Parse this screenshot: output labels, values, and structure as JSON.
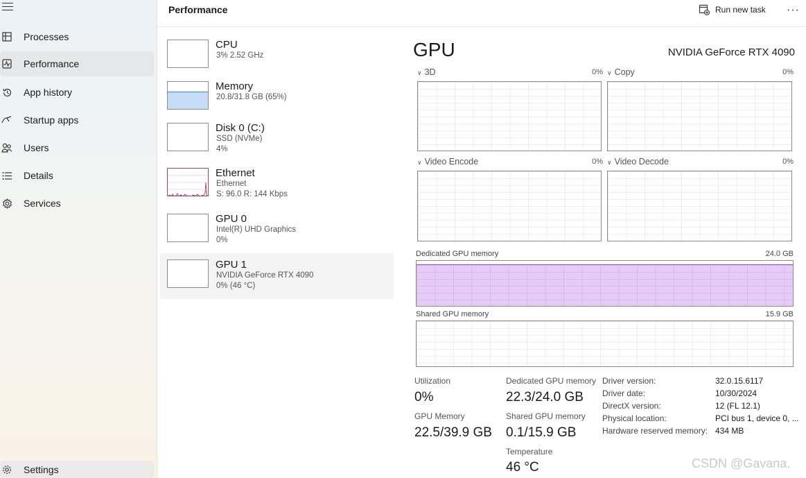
{
  "sidebar": {
    "items": [
      {
        "label": "Processes",
        "icon": "processes-icon"
      },
      {
        "label": "Performance",
        "icon": "performance-icon",
        "active": true
      },
      {
        "label": "App history",
        "icon": "history-icon"
      },
      {
        "label": "Startup apps",
        "icon": "startup-icon"
      },
      {
        "label": "Users",
        "icon": "users-icon"
      },
      {
        "label": "Details",
        "icon": "details-icon"
      },
      {
        "label": "Services",
        "icon": "services-icon"
      }
    ],
    "settings_label": "Settings"
  },
  "header": {
    "title": "Performance",
    "run_new_task": "Run new task",
    "more": "···"
  },
  "devices": [
    {
      "name": "CPU",
      "line1": "3%  2.52 GHz",
      "line2": ""
    },
    {
      "name": "Memory",
      "line1": "20.8/31.8 GB (65%)",
      "line2": "",
      "usage": 0.65
    },
    {
      "name": "Disk 0 (C:)",
      "line1": "SSD (NVMe)",
      "line2": "4%"
    },
    {
      "name": "Ethernet",
      "line1": "Ethernet",
      "line2": "S: 96.0  R: 144 Kbps"
    },
    {
      "name": "GPU 0",
      "line1": "Intel(R) UHD Graphics",
      "line2": "0%"
    },
    {
      "name": "GPU 1",
      "line1": "NVIDIA GeForce RTX 4090",
      "line2": "0%  (46 °C)",
      "selected": true
    }
  ],
  "gpu": {
    "title": "GPU",
    "model": "NVIDIA GeForce RTX 4090",
    "engines": [
      {
        "label": "3D",
        "percent": "0%"
      },
      {
        "label": "Copy",
        "percent": "0%"
      },
      {
        "label": "Video Encode",
        "percent": "0%"
      },
      {
        "label": "Video Decode",
        "percent": "0%"
      }
    ],
    "dedicated": {
      "label": "Dedicated GPU memory",
      "max": "24.0 GB",
      "usage": 0.93
    },
    "shared": {
      "label": "Shared GPU memory",
      "max": "15.9 GB",
      "usage": 0.0
    }
  },
  "stats": {
    "utilization_label": "Utilization",
    "utilization": "0%",
    "dedicated_label": "Dedicated GPU memory",
    "dedicated": "22.3/24.0 GB",
    "gpu_memory_label": "GPU Memory",
    "gpu_memory": "22.5/39.9 GB",
    "shared_label": "Shared GPU memory",
    "shared": "0.1/15.9 GB",
    "temperature_label": "Temperature",
    "temperature": "46 °C"
  },
  "info": [
    {
      "label": "Driver version:",
      "value": "32.0.15.6117"
    },
    {
      "label": "Driver date:",
      "value": "10/30/2024"
    },
    {
      "label": "DirectX version:",
      "value": "12 (FL 12.1)"
    },
    {
      "label": "Physical location:",
      "value": "PCI bus 1, device 0, ..."
    },
    {
      "label": "Hardware reserved memory:",
      "value": "434 MB"
    }
  ],
  "watermark": "CSDN @Gavana.",
  "colors": {
    "memory_fill": "#c5dcf7",
    "ethernet": "#a53e68",
    "dedicated_fill": "#e5ccf6",
    "dedicated_line": "#8e4fc4"
  }
}
